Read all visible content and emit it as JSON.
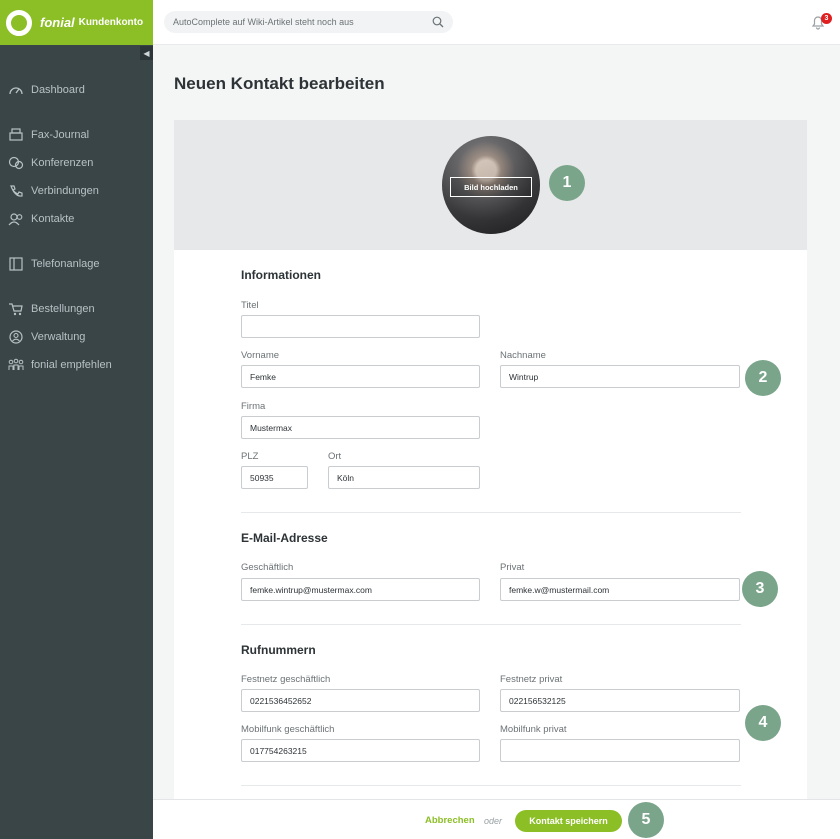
{
  "app": {
    "brand": "fonial",
    "brand_sub": "Kundenkonto"
  },
  "search": {
    "placeholder": "AutoComplete auf Wiki-Artikel steht noch aus"
  },
  "notifications": {
    "count": "3"
  },
  "sidebar": {
    "items": [
      {
        "label": "Dashboard",
        "icon": "gauge-icon"
      },
      {
        "label": "Fax-Journal",
        "icon": "fax-icon"
      },
      {
        "label": "Konferenzen",
        "icon": "conference-icon"
      },
      {
        "label": "Verbindungen",
        "icon": "phone-icon"
      },
      {
        "label": "Kontakte",
        "icon": "contacts-icon"
      },
      {
        "label": "Telefonanlage",
        "icon": "pbx-icon"
      },
      {
        "label": "Bestellungen",
        "icon": "cart-icon"
      },
      {
        "label": "Verwaltung",
        "icon": "user-admin-icon"
      },
      {
        "label": "fonial empfehlen",
        "icon": "recommend-icon"
      }
    ]
  },
  "page": {
    "title": "Neuen Kontakt bearbeiten"
  },
  "photo": {
    "upload_label": "Bild hochladen"
  },
  "steps": [
    "1",
    "2",
    "3",
    "4",
    "5"
  ],
  "info": {
    "title": "Informationen",
    "titel_label": "Titel",
    "titel_value": "",
    "vorname_label": "Vorname",
    "vorname_value": "Femke",
    "nachname_label": "Nachname",
    "nachname_value": "Wintrup",
    "firma_label": "Firma",
    "firma_value": "Mustermax",
    "plz_label": "PLZ",
    "plz_value": "50935",
    "ort_label": "Ort",
    "ort_value": "Köln"
  },
  "email": {
    "title": "E-Mail-Adresse",
    "business_label": "Geschäftlich",
    "business_value": "femke.wintrup@mustermax.com",
    "private_label": "Privat",
    "private_value": "femke.w@mustermail.com"
  },
  "phones": {
    "title": "Rufnummern",
    "landline_business_label": "Festnetz geschäftlich",
    "landline_business_value": "0221536452652",
    "landline_private_label": "Festnetz privat",
    "landline_private_value": "022156532125",
    "mobile_business_label": "Mobilfunk geschäftlich",
    "mobile_business_value": "017754263215",
    "mobile_private_label": "Mobilfunk privat",
    "mobile_private_value": ""
  },
  "footer": {
    "cancel_label": "Abbrechen",
    "or_label": "oder",
    "save_label": "Kontakt speichern"
  },
  "colors": {
    "accent": "#8cbf26",
    "sidebar": "#3a4548",
    "step": "#7aa58a"
  }
}
